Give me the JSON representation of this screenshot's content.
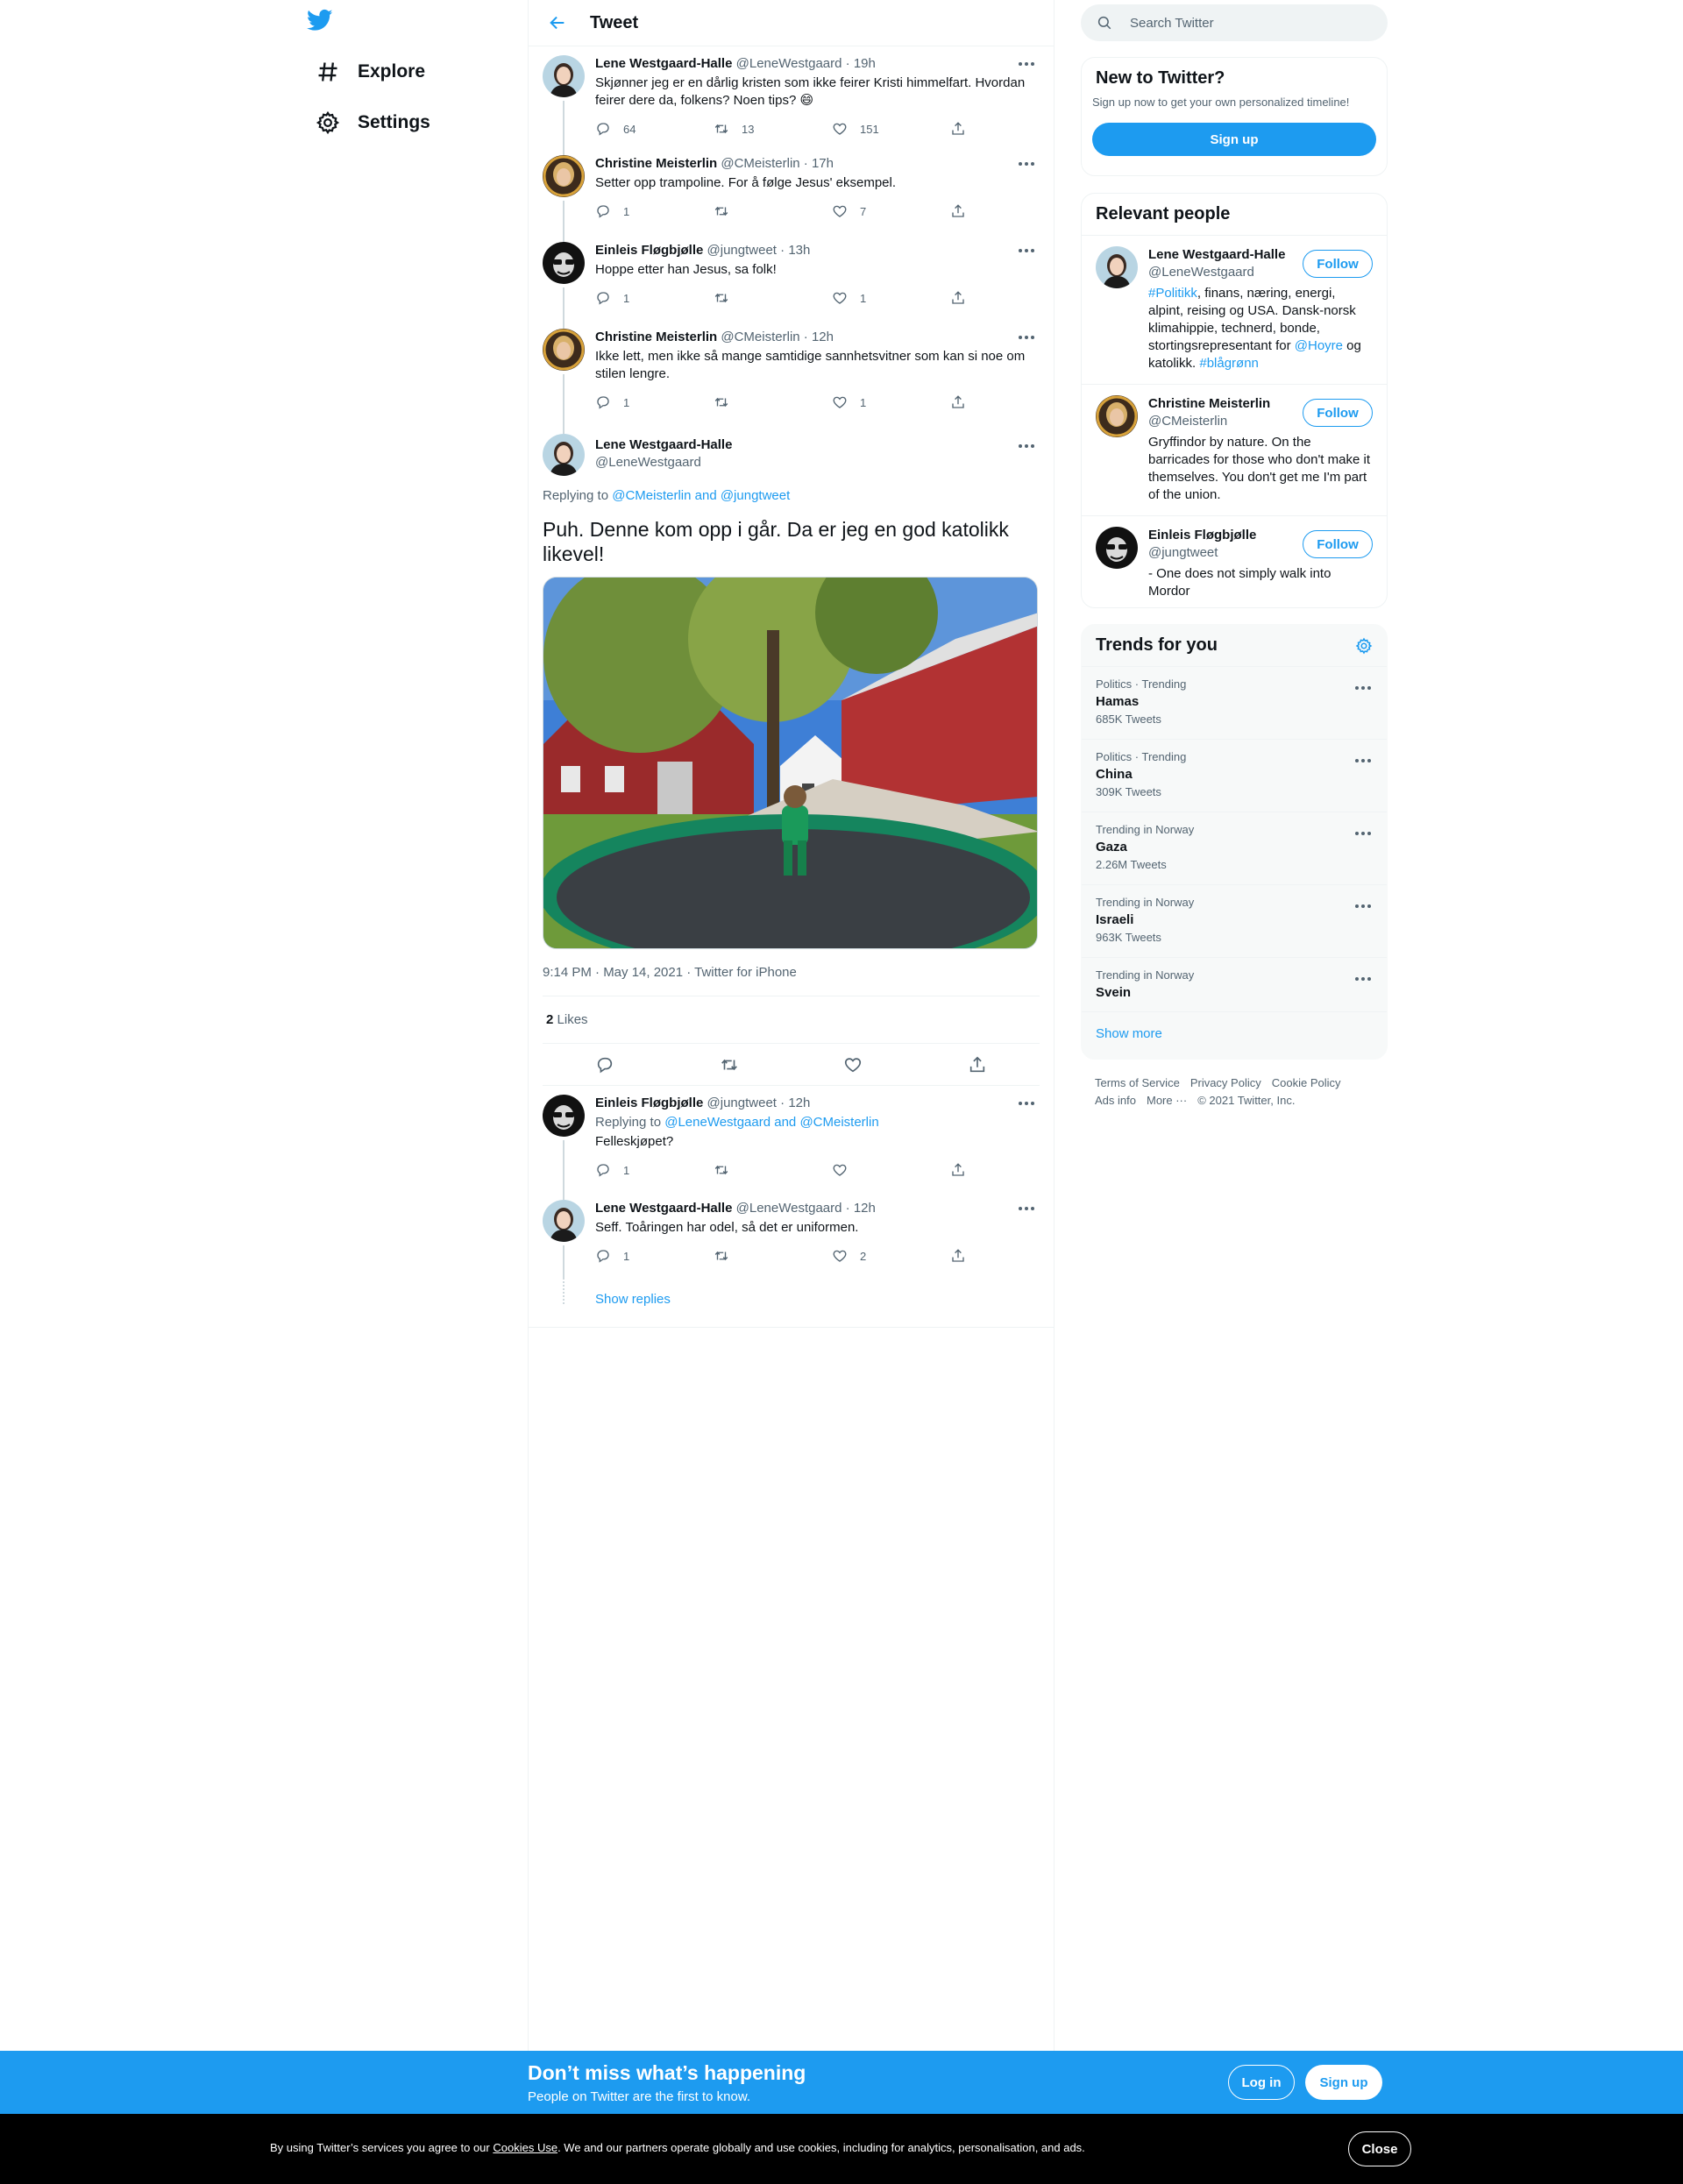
{
  "nav": {
    "logo_icon": "twitter-bird-icon",
    "items": [
      {
        "label": "Explore",
        "icon": "hashtag-icon"
      },
      {
        "label": "Settings",
        "icon": "gear-icon"
      }
    ]
  },
  "header": {
    "title": "Tweet",
    "back_icon": "arrow-left-icon"
  },
  "thread_before": [
    {
      "name": "Lene Westgaard-Halle",
      "handle": "@LeneWestgaard",
      "time": "· 19h",
      "text": "Skjønner jeg er en dårlig kristen som ikke feirer Kristi himmelfart. Hvordan feirer dere da, folkens? Noen tips? 😄",
      "replies": "64",
      "retweets": "13",
      "likes": "151"
    },
    {
      "name": "Christine Meisterlin",
      "handle": "@CMeisterlin",
      "time": "· 17h",
      "text": "Setter opp trampoline. For å følge Jesus' eksempel.",
      "replies": "1",
      "retweets": "",
      "likes": "7"
    },
    {
      "name": "Einleis Fløgbjølle",
      "handle": "@jungtweet",
      "time": "· 13h",
      "text": "Hoppe etter han Jesus, sa folk!",
      "replies": "1",
      "retweets": "",
      "likes": "1"
    },
    {
      "name": "Christine Meisterlin",
      "handle": "@CMeisterlin",
      "time": "· 12h",
      "text": "Ikke lett, men ikke så mange samtidige sannhetsvitner som kan si noe om stilen lengre.",
      "replies": "1",
      "retweets": "",
      "likes": "1"
    }
  ],
  "focal": {
    "name": "Lene Westgaard-Halle",
    "handle": "@LeneWestgaard",
    "replying_prefix": "Replying to",
    "replying_users": "@CMeisterlin and @jungtweet",
    "text": "Puh. Denne kom opp i går. Da er jeg en god katolikk likevel!",
    "meta": "9:14 PM · May 14, 2021 · Twitter for iPhone",
    "likes_count": "2",
    "likes_label": "Likes"
  },
  "replies": [
    {
      "name": "Einleis Fløgbjølle",
      "handle": "@jungtweet",
      "time": "· 12h",
      "replying_prefix": "Replying to",
      "replying_users": "@LeneWestgaard and @CMeisterlin",
      "text": "Felleskjøpet?",
      "replies": "1",
      "retweets": "",
      "likes": ""
    },
    {
      "name": "Lene Westgaard-Halle",
      "handle": "@LeneWestgaard",
      "time": "· 12h",
      "text": "Seff. Toåringen har odel, så det er uniformen.",
      "replies": "1",
      "retweets": "",
      "likes": "2"
    }
  ],
  "show_replies": "Show replies",
  "search": {
    "placeholder": "Search Twitter"
  },
  "new_to_twitter": {
    "title": "New to Twitter?",
    "subtitle": "Sign up now to get your own personalized timeline!",
    "button": "Sign up"
  },
  "relevant_people": {
    "title": "Relevant people",
    "follow_label": "Follow",
    "people": [
      {
        "name": "Lene Westgaard-Halle",
        "handle": "@LeneWestgaard",
        "bio_parts": [
          "#Politikk",
          ", finans, næring, energi, alpint, reising og USA. Dansk-norsk klimahippie, technerd, bonde, stortingsrepresentant for ",
          "@Hoyre",
          " og katolikk. ",
          "#blågrønn"
        ]
      },
      {
        "name": "Christine Meisterlin",
        "handle": "@CMeisterlin",
        "bio": "Gryffindor by nature. On the barricades for those who don't make it themselves. You don't get me I'm part of the union."
      },
      {
        "name": "Einleis Fløgbjølle",
        "handle": "@jungtweet",
        "bio": "- One does not simply walk into Mordor"
      }
    ]
  },
  "trends": {
    "title": "Trends for you",
    "settings_icon": "gear-icon",
    "items": [
      {
        "context": "Politics · Trending",
        "name": "Hamas",
        "count": "685K Tweets"
      },
      {
        "context": "Politics · Trending",
        "name": "China",
        "count": "309K Tweets"
      },
      {
        "context": "Trending in Norway",
        "name": "Gaza",
        "count": "2.26M Tweets"
      },
      {
        "context": "Trending in Norway",
        "name": "Israeli",
        "count": "963K Tweets"
      },
      {
        "context": "Trending in Norway",
        "name": "Svein",
        "count": ""
      }
    ],
    "show_more": "Show more"
  },
  "footer": {
    "links": [
      "Terms of Service",
      "Privacy Policy",
      "Cookie Policy",
      "Ads info",
      "More ···",
      "© 2021 Twitter, Inc."
    ]
  },
  "banner": {
    "title": "Don’t miss what’s happening",
    "subtitle": "People on Twitter are the first to know.",
    "login": "Log in",
    "signup": "Sign up"
  },
  "cookie": {
    "text_before": "By using Twitter’s services you agree to our ",
    "link": "Cookies Use",
    "text_after": ". We and our partners operate globally and use cookies, including for analytics, personalisation, and ads.",
    "close": "Close"
  },
  "colors": {
    "accent": "#1d9bf0",
    "text": "#0f1419",
    "muted": "#536471",
    "border": "#eff3f4",
    "cookie_bg": "#000000"
  }
}
